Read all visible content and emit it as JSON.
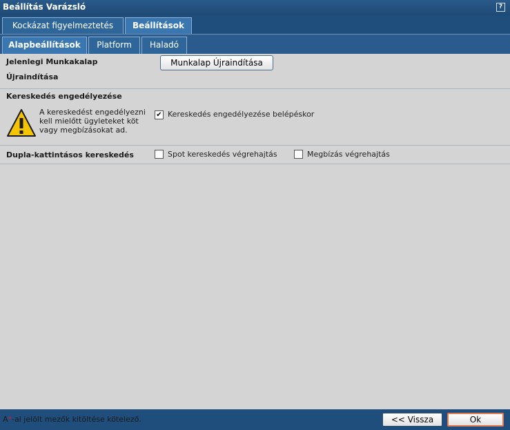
{
  "window": {
    "title": "Beállítás Varázsló",
    "help_label": "?"
  },
  "tabs_top": [
    {
      "label": "Kockázat figyelmeztetés",
      "selected": false
    },
    {
      "label": "Beállítások",
      "selected": true
    }
  ],
  "tabs_sub": [
    {
      "label": "Alapbeállítások",
      "selected": true
    },
    {
      "label": "Platform",
      "selected": false
    },
    {
      "label": "Haladó",
      "selected": false
    }
  ],
  "workspace": {
    "label_line1": "Jelenlegi Munkakalap",
    "label_line2": "Újraindítása",
    "button_label": "Munkalap Újraindítása"
  },
  "trading": {
    "heading": "Kereskedés engedélyezése",
    "warning_text": "A kereskedést engedélyezni kell mielőtt ügyleteket köt vagy megbízásokat ad.",
    "checkbox_label": "Kereskedés engedélyezése belépéskor",
    "checked": true,
    "check_mark": "✔"
  },
  "double_click": {
    "label": "Dupla-kattintásos kereskedés",
    "option1": "Spot kereskedés végrehajtás",
    "option1_checked": false,
    "option2": "Megbízás végrehajtás",
    "option2_checked": false
  },
  "footer": {
    "note_prefix": "A",
    "note_star": "*",
    "note_suffix": "-al jelölt mezők kitöltése kötelező.",
    "back_label": "<< Vissza",
    "ok_label": "Ok"
  }
}
